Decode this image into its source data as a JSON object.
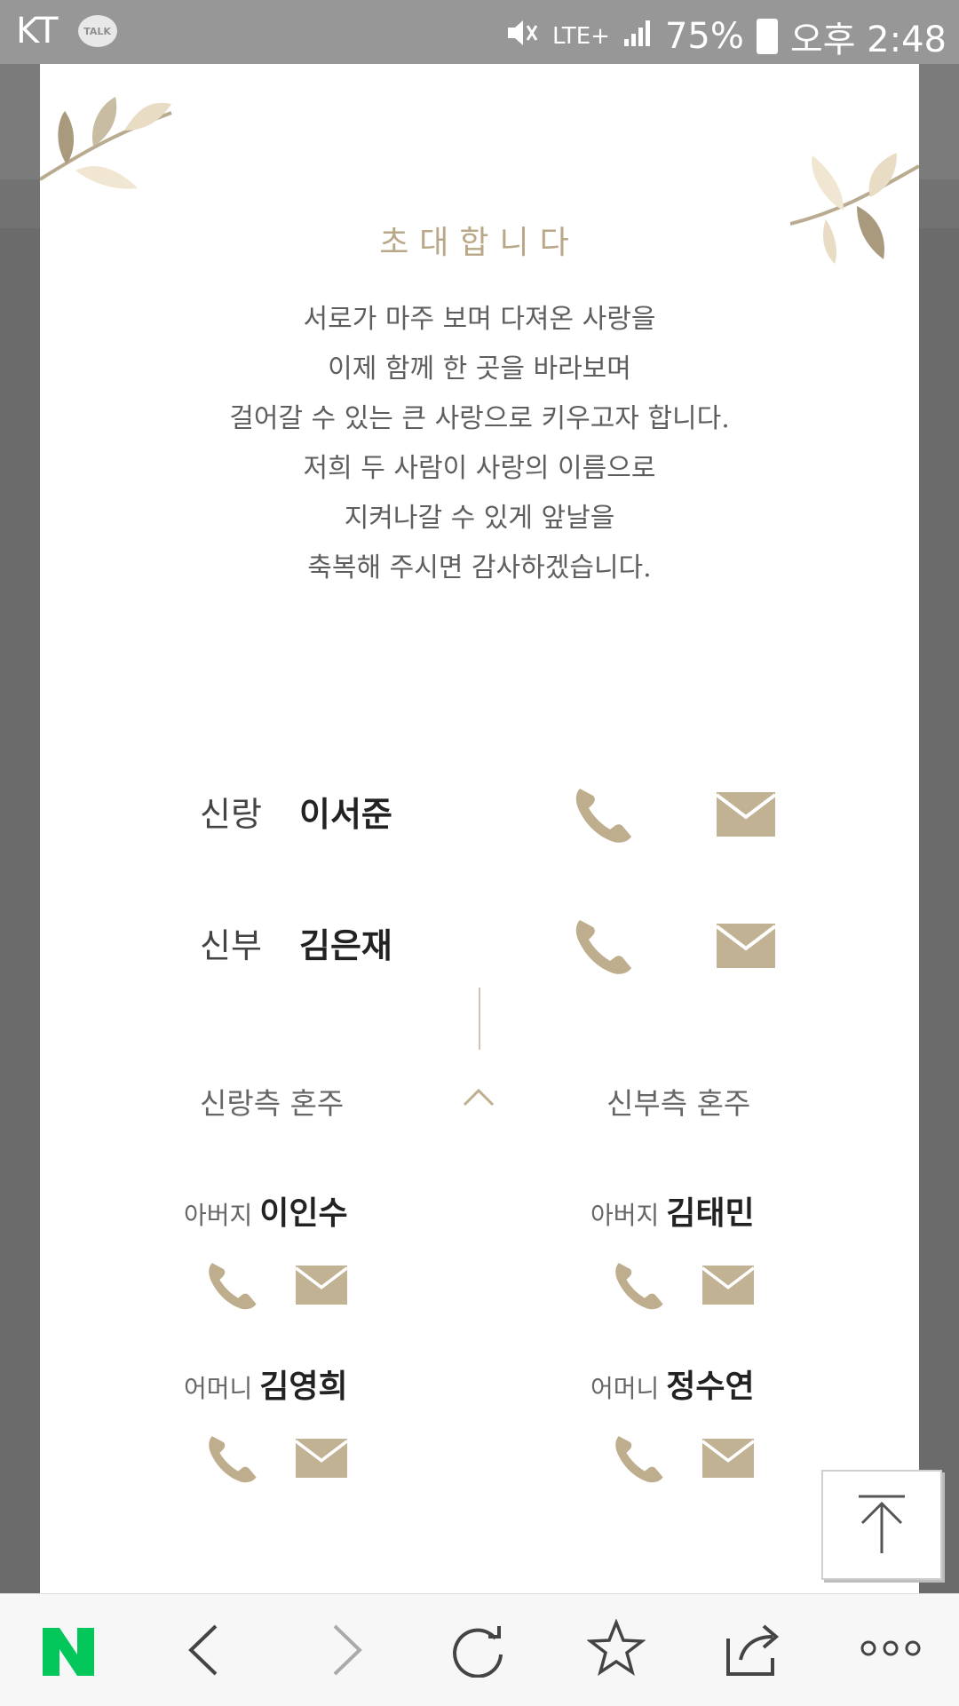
{
  "status": {
    "carrier": "KT",
    "talk_badge": "TALK",
    "network": "LTE+",
    "battery": "75%",
    "time": "오후 2:48"
  },
  "invitation": {
    "title": "초대합니다",
    "message_lines": [
      "서로가 마주 보며 다져온 사랑을",
      "이제 함께 한 곳을 바라보며",
      "걸어갈 수 있는 큰 사랑으로 키우고자 합니다.",
      "저희 두 사람이 사랑의 이름으로",
      "지켜나갈 수 있게 앞날을",
      "축복해 주시면 감사하겠습니다."
    ]
  },
  "couple": {
    "groom": {
      "role": "신랑",
      "name": "이서준"
    },
    "bride": {
      "role": "신부",
      "name": "김은재"
    }
  },
  "hosts": {
    "groom_side_label": "신랑측 혼주",
    "bride_side_label": "신부측 혼주",
    "groom_father": {
      "relation": "아버지",
      "name": "이인수"
    },
    "groom_mother": {
      "relation": "어머니",
      "name": "김영희"
    },
    "bride_father": {
      "relation": "아버지",
      "name": "김태민"
    },
    "bride_mother": {
      "relation": "어머니",
      "name": "정수연"
    }
  },
  "colors": {
    "accent": "#bfae8e",
    "bottom_logo": "#03c75a"
  },
  "icons": [
    "phone-icon",
    "mail-icon",
    "chevron-up-icon",
    "scroll-top-icon",
    "naver-logo",
    "back-icon",
    "forward-icon",
    "refresh-icon",
    "bookmark-star-icon",
    "share-icon",
    "more-icon"
  ]
}
